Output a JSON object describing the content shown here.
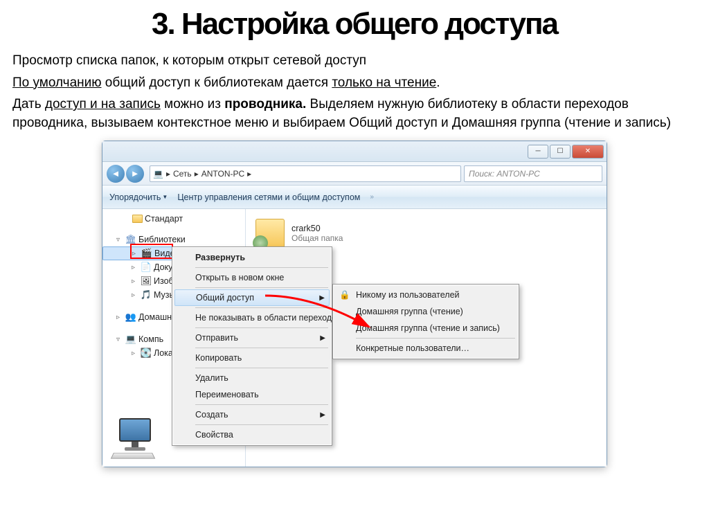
{
  "slide": {
    "title": "3. Настройка общего доступа",
    "p1": "Просмотр списка папок, к которым открыт сетевой доступ",
    "p2a": "По умолчанию",
    "p2b": " общий доступ к библиотекам дается ",
    "p2c": "только на чтение",
    "p2d": ".",
    "p3a": "Дать ",
    "p3b": "доступ и на запись",
    "p3c": " можно из ",
    "p3d": "проводника.",
    "p3e": " Выделяем нужную библиотеку в области переходов проводника, вызываем контекстное меню и выбираем Общий доступ и Домашняя группа (чтение и запись)"
  },
  "explorer": {
    "breadcrumb": {
      "root": "Сеть",
      "pc": "ANTON-PC"
    },
    "search_placeholder": "Поиск: ANTON-PC",
    "toolbar": {
      "organize": "Упорядочить",
      "network_center": "Центр управления сетями и общим доступом"
    },
    "tree": {
      "standard": "Стандарт",
      "libraries": "Библиотеки",
      "video": "Видео",
      "documents": "Докум",
      "pictures": "Изобр",
      "music": "Музы",
      "homegroup": "Домашн",
      "computer": "Компь",
      "local": "Лока"
    },
    "folder": {
      "name": "crark50",
      "sub": "Общая папка"
    }
  },
  "menu1": {
    "expand": "Развернуть",
    "open_new": "Открыть в новом окне",
    "share": "Общий доступ",
    "hide_nav": "Не показывать в области переходов",
    "send": "Отправить",
    "copy": "Копировать",
    "delete": "Удалить",
    "rename": "Переименовать",
    "create": "Создать",
    "properties": "Свойства"
  },
  "menu2": {
    "nobody": "Никому из пользователей",
    "hg_read": "Домашняя группа (чтение)",
    "hg_rw": "Домашняя группа (чтение и запись)",
    "specific": "Конкретные пользователи…"
  }
}
